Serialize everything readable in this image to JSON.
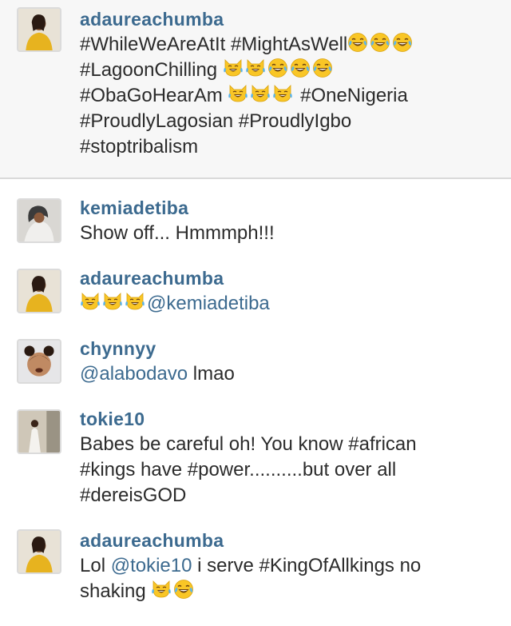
{
  "caption": {
    "username": "adaureachumba",
    "lines": [
      "#WhileWeAreAtIt #MightAsWell",
      "#LagoonChilling",
      "#ObaGoHearAm",
      "#OneNigeria",
      "#ProudlyLagosian #ProudlyIgbo",
      "#stoptribalism"
    ]
  },
  "comments": [
    {
      "username": "kemiadetiba",
      "text": "Show off... Hmmmph!!!"
    },
    {
      "username": "adaureachumba",
      "mention": "@kemiadetiba"
    },
    {
      "username": "chynnyy",
      "mention": "@alabodavo",
      "text": " lmao"
    },
    {
      "username": "tokie10",
      "lines": [
        "Babes be careful oh! You know #african",
        "#kings have #power..........but over all",
        "#dereisGOD"
      ]
    },
    {
      "username": "adaureachumba",
      "pre": "Lol ",
      "mention": "@tokie10",
      "post": " i serve #KingOfAllkings no",
      "line2": "shaking"
    }
  ],
  "icons": {
    "laugh": "face-with-tears-of-joy-icon",
    "cat": "cat-with-tears-of-joy-icon"
  },
  "colors": {
    "username": "#3c6a8f",
    "text": "#2b2b2b",
    "caption_bg": "#f7f7f7"
  }
}
